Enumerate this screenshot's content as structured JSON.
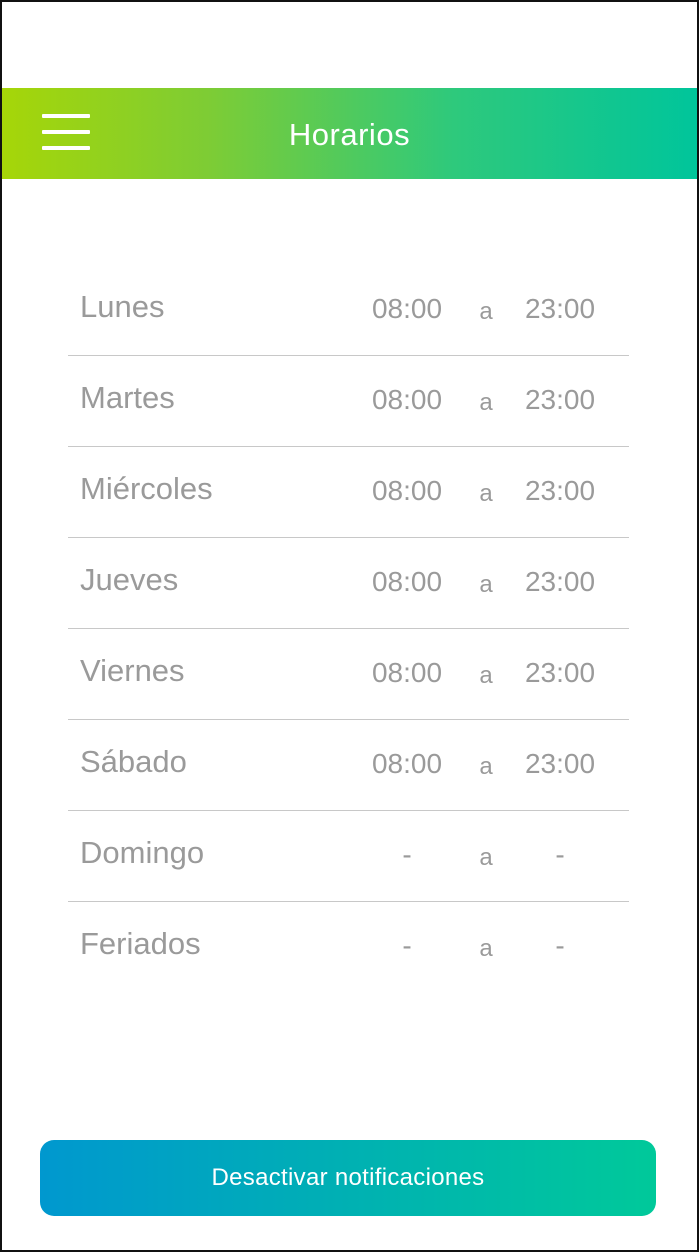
{
  "header": {
    "title": "Horarios"
  },
  "schedule": {
    "separator": "a",
    "rows": [
      {
        "day": "Lunes",
        "from": "08:00",
        "to": "23:00"
      },
      {
        "day": "Martes",
        "from": "08:00",
        "to": "23:00"
      },
      {
        "day": "Miércoles",
        "from": "08:00",
        "to": "23:00"
      },
      {
        "day": "Jueves",
        "from": "08:00",
        "to": "23:00"
      },
      {
        "day": "Viernes",
        "from": "08:00",
        "to": "23:00"
      },
      {
        "day": "Sábado",
        "from": "08:00",
        "to": "23:00"
      },
      {
        "day": "Domingo",
        "from": "-",
        "to": "-"
      },
      {
        "day": "Feriados",
        "from": "-",
        "to": "-"
      }
    ]
  },
  "footer": {
    "button_label": "Desactivar notificaciones"
  },
  "icons": {
    "menu": "hamburger-menu-icon"
  },
  "colors": {
    "header_gradient_start": "#a6d608",
    "header_gradient_end": "#00c59b",
    "button_gradient_start": "#0098cf",
    "button_gradient_end": "#00c99a",
    "text_muted": "#9a9a9a",
    "divider": "#c8c8c8"
  }
}
